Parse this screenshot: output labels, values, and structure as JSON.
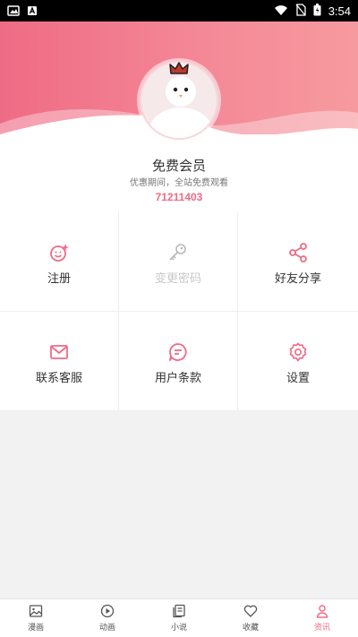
{
  "status_bar": {
    "time": "3:54"
  },
  "profile": {
    "title": "免费会员",
    "subtitle": "优惠期间，全站免费观看",
    "user_id": "71211403"
  },
  "menu": {
    "items": [
      {
        "label": "注册",
        "icon": "smile-sparkle-icon",
        "enabled": true
      },
      {
        "label": "变更密码",
        "icon": "key-icon",
        "enabled": false
      },
      {
        "label": "好友分享",
        "icon": "share-icon",
        "enabled": true
      },
      {
        "label": "联系客服",
        "icon": "mail-icon",
        "enabled": true
      },
      {
        "label": "用户条款",
        "icon": "chat-terms-icon",
        "enabled": true
      },
      {
        "label": "设置",
        "icon": "gear-icon",
        "enabled": true
      }
    ]
  },
  "bottom_nav": {
    "items": [
      {
        "label": "漫画",
        "icon": "image-icon"
      },
      {
        "label": "动画",
        "icon": "play-circle-icon"
      },
      {
        "label": "小说",
        "icon": "book-icon"
      },
      {
        "label": "收藏",
        "icon": "heart-icon"
      },
      {
        "label": "资讯",
        "icon": "person-icon",
        "active": true
      }
    ]
  },
  "colors": {
    "accent": "#ef6b85",
    "header_start": "#ef6b85",
    "header_end": "#f79a9f",
    "icon_disabled": "#b8b8b8"
  }
}
